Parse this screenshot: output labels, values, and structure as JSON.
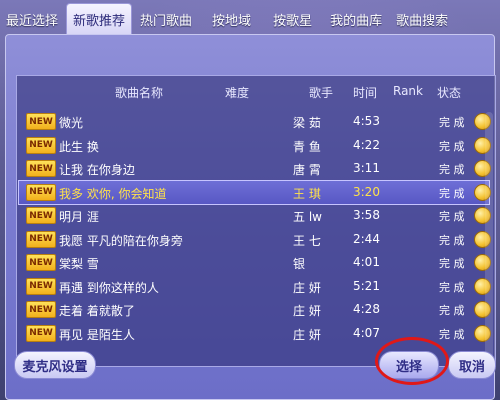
{
  "tabs": [
    {
      "label": "最近选择",
      "active": false
    },
    {
      "label": "新歌推荐",
      "active": true
    },
    {
      "label": "热门歌曲",
      "active": false
    },
    {
      "label": "按地域",
      "active": false
    },
    {
      "label": "按歌星",
      "active": false
    },
    {
      "label": "我的曲库",
      "active": false
    },
    {
      "label": "歌曲搜索",
      "active": false
    }
  ],
  "columns": {
    "name": "歌曲名称",
    "difficulty": "难度",
    "singer": "歌手",
    "time": "时间",
    "rank": "Rank",
    "status": "状态"
  },
  "badge_label": "NEW",
  "songs": [
    {
      "name": "微光",
      "singer": "梁  茹",
      "time": "4:53",
      "status": "完 成"
    },
    {
      "name": "此生  换",
      "singer": "青  鱼",
      "time": "4:22",
      "status": "完 成"
    },
    {
      "name": "让我  在你身边",
      "singer": "唐  霄",
      "time": "3:11",
      "status": "完 成"
    },
    {
      "name": "我多  欢你, 你会知道",
      "singer": "王  琪",
      "time": "3:20",
      "status": "完 成",
      "selected": true
    },
    {
      "name": "明月  涯",
      "singer": "五  lw",
      "time": "3:58",
      "status": "完 成"
    },
    {
      "name": "我愿  平凡的陪在你身旁",
      "singer": "王  七",
      "time": "2:44",
      "status": "完 成"
    },
    {
      "name": "棠梨  雪",
      "singer": "银  ",
      "time": "4:01",
      "status": "完 成"
    },
    {
      "name": "再遇  到你这样的人",
      "singer": "庄  妍",
      "time": "5:21",
      "status": "完 成"
    },
    {
      "name": "走着  着就散了",
      "singer": "庄  妍",
      "time": "4:28",
      "status": "完 成"
    },
    {
      "name": "再见  是陌生人",
      "singer": "庄  妍",
      "time": "4:07",
      "status": "完 成"
    }
  ],
  "buttons": {
    "mic_settings": "麦克风设置",
    "select": "选择",
    "cancel": "取消"
  },
  "colors": {
    "selected_text": "#ffe24a",
    "highlight_ring": "#e01818"
  }
}
